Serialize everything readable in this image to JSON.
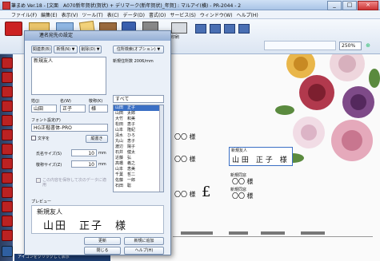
{
  "window": {
    "title": "筆まめ Ver.18 - [文面　A070新年賀状(賀状) + デリマーク(新年賀状)_年賀] : マルアイ(横) - PR-2044 - 2",
    "controls": [
      "_",
      "□",
      "×"
    ]
  },
  "menu": [
    "ファイル(F)",
    "編集(E)",
    "表示(V)",
    "ツール(T)",
    "表(C)",
    "データ(D)",
    "書式(O)",
    "サービス(S)",
    "ウィンドウ(W)",
    "ヘルプ(H)"
  ],
  "toolbar": {
    "zoom_value": "250%",
    "tab_label": "宛名面",
    "tab2_label": "印刷"
  },
  "dialog": {
    "title": "連名宛先の設定",
    "top_buttons": [
      "関連表(B)",
      "新規(N) ▼",
      "削除(D) ▼"
    ],
    "settings_button": "住所検索(オプション) ▼",
    "group_value": "新規友人",
    "group_info": "新規住所数 2006/mm",
    "label_sei": "姓(J)",
    "label_mei": "名(W)",
    "label_keisho": "敬称(K)",
    "sei_value": "山田",
    "mei_value": "正子",
    "keisho_value": "様",
    "font_label": "フォント設定(F)",
    "font_value": "HG正楷書体-PRO",
    "size_unit": "mm",
    "size_label1": "氏名サイズ(S)",
    "size_value1": "10",
    "size_label2": "敬称サイズ(Z)",
    "size_value2": "10",
    "check_label": "文字を",
    "vertical_label": "縦書き",
    "option_label": "この内容を保存して次のデータに適用",
    "filter_value": "すべて",
    "names": [
      "山田　正子",
      "山田　太郎",
      "大竹　和美",
      "松田　恵子",
      "山本　隆紀",
      "清水　ひろ",
      "丸山　恵子",
      "渡辺　陽子",
      "石井　健太",
      "近藤　弘",
      "高橋　義之",
      "山本　恵美",
      "千葉　哲二",
      "佐藤　一郎",
      "石田　聡",
      "小林　裕"
    ],
    "preview_label": "プレビュー",
    "preview_sub": "新規友人",
    "preview_name": "山田　正子　様",
    "bottom_buttons": [
      "更新",
      "新規に追加"
    ],
    "ok_label": "閉じる",
    "help_label": "ヘルプ(H)"
  },
  "canvas": {
    "sama": [
      "〇〇 様",
      "〇〇 様",
      "〇〇 様",
      "〇〇 様",
      "〇〇 様",
      "〇〇 様"
    ],
    "card_group": "新規友人",
    "card_name": "山 田　正 子　様",
    "card_label": "新規同窓"
  },
  "footer_link": "アイコンをクリックして表示"
}
